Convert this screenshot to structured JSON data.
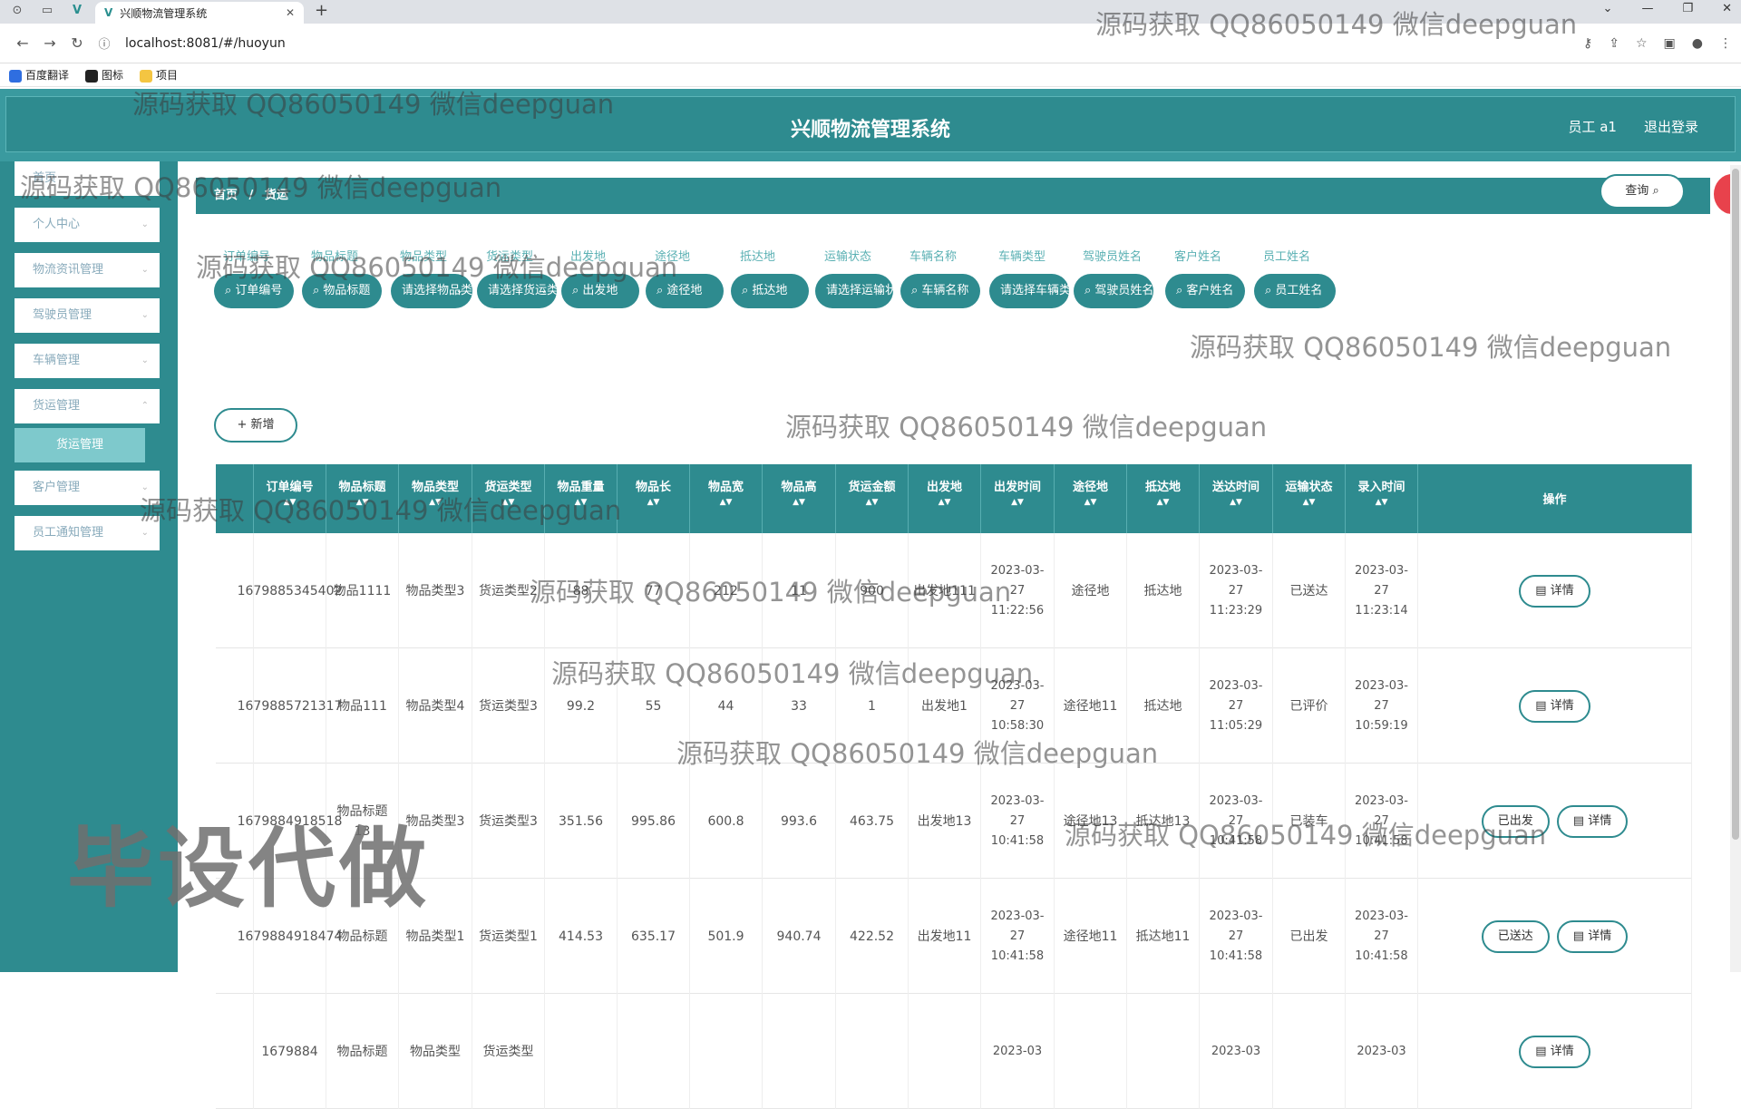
{
  "browser": {
    "tab_title": "兴顺物流管理系统",
    "url": "localhost:8081/#/huoyun",
    "bookmarks": [
      "百度翻译",
      "图标",
      "项目"
    ]
  },
  "header": {
    "title": "兴顺物流管理系统",
    "user": "员工 a1",
    "logout": "退出登录"
  },
  "sidebar": {
    "items": [
      "首页",
      "个人中心",
      "物流资讯管理",
      "驾驶员管理",
      "车辆管理",
      "货运管理",
      "客户管理",
      "员工通知管理"
    ],
    "active_sub": "货运管理"
  },
  "breadcrumb": {
    "home": "首页",
    "sep": "/",
    "current": "货运"
  },
  "filters": [
    {
      "label": "订单编号",
      "placeholder": "订单编号"
    },
    {
      "label": "物品标题",
      "placeholder": "物品标题"
    },
    {
      "label": "物品类型",
      "placeholder": "请选择物品类型"
    },
    {
      "label": "货运类型",
      "placeholder": "请选择货运类型"
    },
    {
      "label": "出发地",
      "placeholder": "出发地"
    },
    {
      "label": "途径地",
      "placeholder": "途径地"
    },
    {
      "label": "抵达地",
      "placeholder": "抵达地"
    },
    {
      "label": "运输状态",
      "placeholder": "请选择运输状态"
    },
    {
      "label": "车辆名称",
      "placeholder": "车辆名称"
    },
    {
      "label": "车辆类型",
      "placeholder": "请选择车辆类型"
    },
    {
      "label": "驾驶员姓名",
      "placeholder": "驾驶员姓名"
    },
    {
      "label": "客户姓名",
      "placeholder": "客户姓名"
    },
    {
      "label": "员工姓名",
      "placeholder": "员工姓名"
    }
  ],
  "buttons": {
    "query": "查询",
    "add": "+ 新增",
    "detail": "详情",
    "depart": "已出发",
    "arrived": "已送达"
  },
  "table": {
    "columns": [
      "订单编号",
      "物品标题",
      "物品类型",
      "货运类型",
      "物品重量",
      "物品长",
      "物品宽",
      "物品高",
      "货运金额",
      "出发地",
      "出发时间",
      "途径地",
      "抵达地",
      "送达时间",
      "运输状态",
      "录入时间",
      "操作"
    ],
    "rows": [
      [
        "1679885345402",
        "物品1111",
        "物品类型3",
        "货运类型2",
        "88",
        "77",
        "212",
        "11",
        "900",
        "出发地111",
        "2023-03-27 11:22:56",
        "途径地",
        "抵达地",
        "2023-03-27 11:23:29",
        "已送达",
        "2023-03-27 11:23:14"
      ],
      [
        "1679885721317",
        "物品111",
        "物品类型4",
        "货运类型3",
        "99.2",
        "55",
        "44",
        "33",
        "1",
        "出发地1",
        "2023-03-27 10:58:30",
        "途径地11",
        "抵达地",
        "2023-03-27 11:05:29",
        "已评价",
        "2023-03-27 10:59:19"
      ],
      [
        "1679884918518",
        "物品标题13",
        "物品类型3",
        "货运类型3",
        "351.56",
        "995.86",
        "600.8",
        "993.6",
        "463.75",
        "出发地13",
        "2023-03-27 10:41:58",
        "途径地13",
        "抵达地13",
        "2023-03-27 10:41:58",
        "已装车",
        "2023-03-27 10:41:58"
      ],
      [
        "1679884918474",
        "物品标题",
        "物品类型1",
        "货运类型1",
        "414.53",
        "635.17",
        "501.9",
        "940.74",
        "422.52",
        "出发地11",
        "2023-03-27 10:41:58",
        "途径地11",
        "抵达地11",
        "2023-03-27 10:41:58",
        "已出发",
        "2023-03-27 10:41:58"
      ],
      [
        "1679884",
        "物品标题",
        "物品类型",
        "货运类型",
        "",
        "",
        "",
        "",
        "",
        "",
        "2023-03",
        "",
        "",
        "2023-03",
        "",
        "2023-03"
      ]
    ],
    "row_actions": [
      [
        "详情"
      ],
      [
        "详情"
      ],
      [
        "已出发",
        "详情"
      ],
      [
        "已送达",
        "详情"
      ],
      [
        "详情"
      ]
    ]
  },
  "watermarks": [
    "源码获取 QQ86050149 微信deepguan"
  ],
  "watermark_big": "毕设代做",
  "colors": {
    "primary": "#2e8b8f",
    "label": "#5ab0b3"
  }
}
